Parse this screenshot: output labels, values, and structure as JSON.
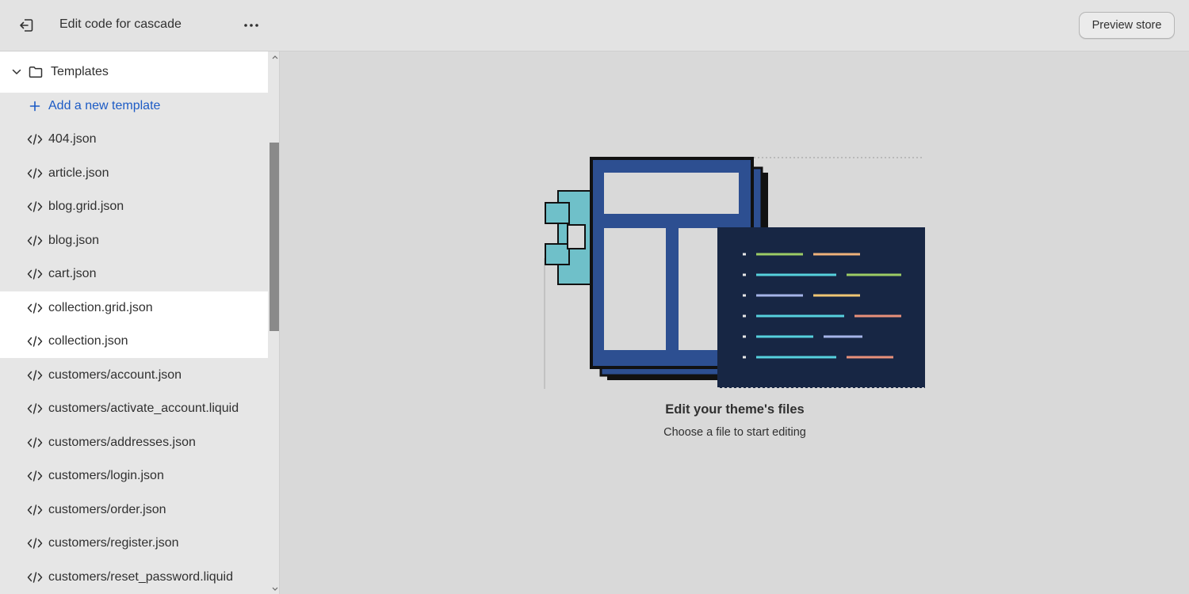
{
  "header": {
    "exit_icon": "exit-icon",
    "title": "Edit code for cascade",
    "more_icon": "ellipsis-icon",
    "preview_label": "Preview store"
  },
  "sidebar": {
    "folder": {
      "label": "Templates",
      "expanded": true,
      "icon": "folder-icon"
    },
    "add_label": "Add a new template",
    "files": [
      "404.json",
      "article.json",
      "blog.grid.json",
      "blog.json",
      "cart.json",
      "collection.grid.json",
      "collection.json",
      "customers/account.json",
      "customers/activate_account.liquid",
      "customers/addresses.json",
      "customers/login.json",
      "customers/order.json",
      "customers/register.json",
      "customers/reset_password.liquid"
    ],
    "file_icon": "code-icon"
  },
  "main": {
    "empty_title": "Edit your theme's files",
    "empty_subtitle": "Choose a file to start editing"
  },
  "colors": {
    "accent_link": "#1c5bc5",
    "illustration_blue": "#2d4f91",
    "illustration_navy": "#172644",
    "illustration_teal": "#6fc0c9"
  }
}
